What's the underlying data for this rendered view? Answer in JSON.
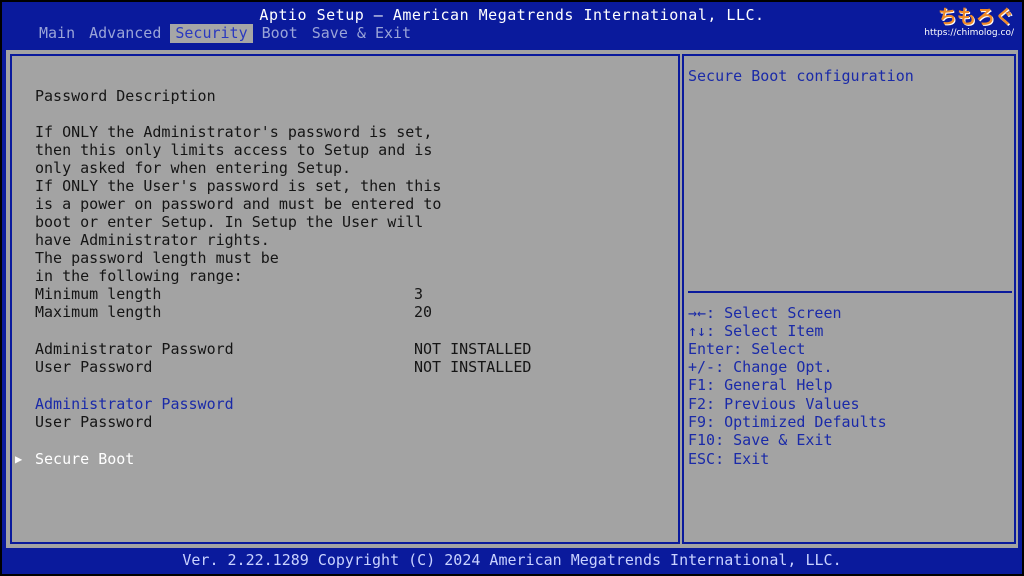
{
  "header": {
    "title": "Aptio Setup – American Megatrends International, LLC.",
    "logo_text": "ちもろぐ",
    "logo_url": "https://chimolog.co/"
  },
  "tabs": [
    {
      "label": "Main"
    },
    {
      "label": "Advanced"
    },
    {
      "label": "Security",
      "active": true
    },
    {
      "label": "Boot"
    },
    {
      "label": "Save & Exit"
    }
  ],
  "left": {
    "section_title": "Password Description",
    "description_lines": [
      "If ONLY the Administrator's password is set,",
      "then this only limits access to Setup and is",
      "only asked for when entering Setup.",
      "If ONLY the User's password is set, then this",
      "is a power on password and must be entered to",
      "boot or enter Setup. In Setup the User will",
      "have Administrator rights.",
      "The password length must be",
      "in the following range:"
    ],
    "min_label": "Minimum length",
    "min_value": "3",
    "max_label": "Maximum length",
    "max_value": "20",
    "admin_status_label": "Administrator Password",
    "admin_status_value": "NOT INSTALLED",
    "user_status_label": "User Password",
    "user_status_value": "NOT INSTALLED",
    "admin_password_item": "Administrator Password",
    "user_password_item": "User Password",
    "secure_boot_item": "Secure Boot"
  },
  "right": {
    "item_help": "Secure Boot configuration",
    "key_help": [
      "→←: Select Screen",
      "↑↓: Select Item",
      "Enter: Select",
      "+/-: Change Opt.",
      "F1: General Help",
      "F2: Previous Values",
      "F9: Optimized Defaults",
      "F10: Save & Exit",
      "ESC: Exit"
    ]
  },
  "footer": {
    "text": "Ver. 2.22.1289 Copyright (C) 2024 American Megatrends International, LLC."
  },
  "colors": {
    "frame_blue": "#0a1a9c",
    "panel_gray": "#a3a3a3",
    "highlight_blue": "#1a2aa8",
    "logo_orange": "#f08a28"
  }
}
